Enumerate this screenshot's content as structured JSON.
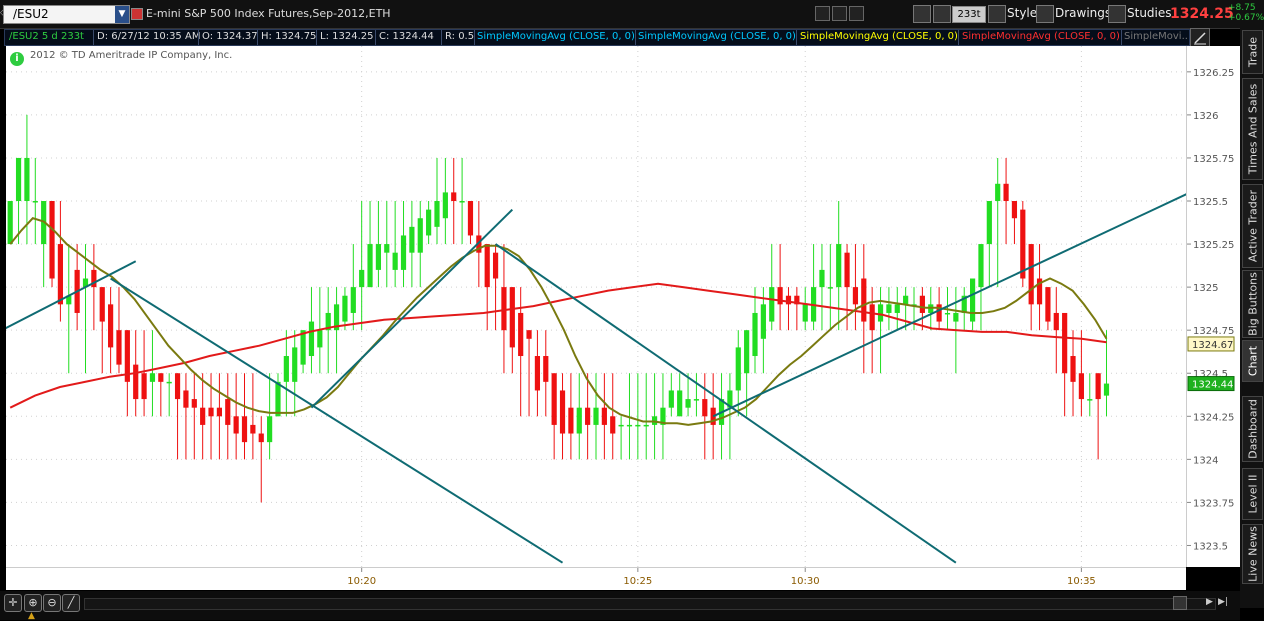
{
  "header": {
    "symbol": "/ESU2",
    "description": "E-mini S&P 500 Index Futures,Sep-2012,ETH",
    "aggregation": "233t",
    "style_label": "Style",
    "drawings_label": "Drawings",
    "studies_label": "Studies",
    "last_price": "1324.25",
    "change_abs": "+8.75",
    "change_pct": "+0.67%"
  },
  "infobar": {
    "symbol_info": "/ESU2 5 d 233t",
    "date": "D: 6/27/12 10:35 AM",
    "open": "O: 1324.37",
    "high": "H: 1324.75",
    "low": "L: 1324.25",
    "close": "C: 1324.44",
    "range": "R: 0.5",
    "study1": "SimpleMovingAvg (CLOSE, 0, 0)",
    "study2": "SimpleMovingAvg (CLOSE, 0, 0)",
    "study3": "SimpleMovingAvg (CLOSE, 0, 0)",
    "study4": "SimpleMovingAvg (CLOSE, 0, 0)",
    "study5": "SimpleMovi..."
  },
  "copyright": "2012 © TD Ameritrade IP Company, Inc.",
  "side_tabs": [
    "Trade",
    "Times And Sales",
    "Active Trader",
    "Big Buttons",
    "Chart",
    "Dashboard",
    "Level II",
    "Live News"
  ],
  "active_side_tab": "Chart",
  "colors": {
    "up": "#22dd22",
    "down": "#ee1111",
    "sma_fast": "#7a7a10",
    "sma_slow": "#e21a1a",
    "trendline": "#0f6b73",
    "infobar_symbol": "#2ecc40",
    "study1": "#00c8ff",
    "study2": "#00c8ff",
    "study3": "#ffff00",
    "study4": "#ff3030",
    "study5": "#777777"
  },
  "chart_data": {
    "type": "candlestick",
    "ylim": [
      1323.375,
      1326.4
    ],
    "y_ticks": [
      "1326.25",
      "1326",
      "1325.75",
      "1325.5",
      "1325.25",
      "1325",
      "1324.75",
      "1324.5",
      "1324.25",
      "1324",
      "1323.75",
      "1323.5"
    ],
    "x_ticks": [
      {
        "bar": 42,
        "label": "10:20"
      },
      {
        "bar": 75,
        "label": "10:25"
      },
      {
        "bar": 95,
        "label": "10:30"
      },
      {
        "bar": 128,
        "label": "10:35"
      }
    ],
    "n_slots": 141,
    "price_markers": [
      {
        "value": 1324.67,
        "label": "1324.67",
        "style": "olive"
      },
      {
        "value": 1324.44,
        "label": "1324.44",
        "style": "green"
      }
    ],
    "candles": [
      {
        "o": 1325.25,
        "h": 1325.5,
        "l": 1325.25,
        "c": 1325.5
      },
      {
        "o": 1325.5,
        "h": 1325.75,
        "l": 1325.25,
        "c": 1325.75
      },
      {
        "o": 1325.5,
        "h": 1326.0,
        "l": 1325.25,
        "c": 1325.75
      },
      {
        "o": 1325.5,
        "h": 1325.75,
        "l": 1325.25,
        "c": 1325.5
      },
      {
        "o": 1325.25,
        "h": 1325.5,
        "l": 1325.0,
        "c": 1325.5
      },
      {
        "o": 1325.5,
        "h": 1325.5,
        "l": 1325.0,
        "c": 1325.05
      },
      {
        "o": 1325.25,
        "h": 1325.5,
        "l": 1324.8,
        "c": 1324.9
      },
      {
        "o": 1324.9,
        "h": 1325.25,
        "l": 1324.5,
        "c": 1324.95
      },
      {
        "o": 1325.1,
        "h": 1325.25,
        "l": 1324.75,
        "c": 1324.85
      },
      {
        "o": 1325.0,
        "h": 1325.25,
        "l": 1324.5,
        "c": 1325.05
      },
      {
        "o": 1325.1,
        "h": 1325.25,
        "l": 1324.75,
        "c": 1325.0
      },
      {
        "o": 1325.0,
        "h": 1325.0,
        "l": 1324.5,
        "c": 1324.8
      },
      {
        "o": 1324.9,
        "h": 1325.0,
        "l": 1324.5,
        "c": 1324.65
      },
      {
        "o": 1324.75,
        "h": 1325.0,
        "l": 1324.5,
        "c": 1324.55
      },
      {
        "o": 1324.75,
        "h": 1324.75,
        "l": 1324.25,
        "c": 1324.45
      },
      {
        "o": 1324.55,
        "h": 1324.75,
        "l": 1324.25,
        "c": 1324.35
      },
      {
        "o": 1324.5,
        "h": 1324.75,
        "l": 1324.25,
        "c": 1324.35
      },
      {
        "o": 1324.45,
        "h": 1324.75,
        "l": 1324.25,
        "c": 1324.5
      },
      {
        "o": 1324.5,
        "h": 1324.5,
        "l": 1324.25,
        "c": 1324.45
      },
      {
        "o": 1324.45,
        "h": 1324.5,
        "l": 1324.25,
        "c": 1324.45
      },
      {
        "o": 1324.5,
        "h": 1324.5,
        "l": 1324.0,
        "c": 1324.35
      },
      {
        "o": 1324.4,
        "h": 1324.5,
        "l": 1324.0,
        "c": 1324.3
      },
      {
        "o": 1324.35,
        "h": 1324.5,
        "l": 1324.0,
        "c": 1324.3
      },
      {
        "o": 1324.3,
        "h": 1324.5,
        "l": 1324.0,
        "c": 1324.2
      },
      {
        "o": 1324.3,
        "h": 1324.5,
        "l": 1324.0,
        "c": 1324.25
      },
      {
        "o": 1324.3,
        "h": 1324.5,
        "l": 1324.0,
        "c": 1324.25
      },
      {
        "o": 1324.35,
        "h": 1324.5,
        "l": 1324.0,
        "c": 1324.2
      },
      {
        "o": 1324.25,
        "h": 1324.5,
        "l": 1324.0,
        "c": 1324.15
      },
      {
        "o": 1324.25,
        "h": 1324.5,
        "l": 1324.0,
        "c": 1324.1
      },
      {
        "o": 1324.2,
        "h": 1324.5,
        "l": 1324.0,
        "c": 1324.15
      },
      {
        "o": 1324.15,
        "h": 1324.25,
        "l": 1323.75,
        "c": 1324.1
      },
      {
        "o": 1324.1,
        "h": 1324.5,
        "l": 1324.0,
        "c": 1324.25
      },
      {
        "o": 1324.25,
        "h": 1324.5,
        "l": 1324.25,
        "c": 1324.45
      },
      {
        "o": 1324.45,
        "h": 1324.75,
        "l": 1324.25,
        "c": 1324.6
      },
      {
        "o": 1324.45,
        "h": 1324.75,
        "l": 1324.25,
        "c": 1324.65
      },
      {
        "o": 1324.55,
        "h": 1324.75,
        "l": 1324.5,
        "c": 1324.75
      },
      {
        "o": 1324.6,
        "h": 1325.0,
        "l": 1324.5,
        "c": 1324.8
      },
      {
        "o": 1324.65,
        "h": 1325.0,
        "l": 1324.5,
        "c": 1324.75
      },
      {
        "o": 1324.75,
        "h": 1325.0,
        "l": 1324.5,
        "c": 1324.85
      },
      {
        "o": 1324.75,
        "h": 1325.0,
        "l": 1324.5,
        "c": 1324.9
      },
      {
        "o": 1324.8,
        "h": 1325.0,
        "l": 1324.75,
        "c": 1324.95
      },
      {
        "o": 1324.85,
        "h": 1325.25,
        "l": 1324.75,
        "c": 1325.0
      },
      {
        "o": 1325.0,
        "h": 1325.5,
        "l": 1324.75,
        "c": 1325.1
      },
      {
        "o": 1325.0,
        "h": 1325.5,
        "l": 1325.0,
        "c": 1325.25
      },
      {
        "o": 1325.1,
        "h": 1325.5,
        "l": 1325.0,
        "c": 1325.25
      },
      {
        "o": 1325.2,
        "h": 1325.5,
        "l": 1325.0,
        "c": 1325.25
      },
      {
        "o": 1325.1,
        "h": 1325.5,
        "l": 1325.0,
        "c": 1325.2
      },
      {
        "o": 1325.1,
        "h": 1325.5,
        "l": 1325.0,
        "c": 1325.3
      },
      {
        "o": 1325.2,
        "h": 1325.5,
        "l": 1325.0,
        "c": 1325.35
      },
      {
        "o": 1325.2,
        "h": 1325.5,
        "l": 1325.0,
        "c": 1325.4
      },
      {
        "o": 1325.3,
        "h": 1325.5,
        "l": 1325.25,
        "c": 1325.45
      },
      {
        "o": 1325.35,
        "h": 1325.75,
        "l": 1325.25,
        "c": 1325.5
      },
      {
        "o": 1325.4,
        "h": 1325.75,
        "l": 1325.25,
        "c": 1325.55
      },
      {
        "o": 1325.55,
        "h": 1325.75,
        "l": 1325.25,
        "c": 1325.5
      },
      {
        "o": 1325.5,
        "h": 1325.75,
        "l": 1325.25,
        "c": 1325.5
      },
      {
        "o": 1325.5,
        "h": 1325.5,
        "l": 1325.25,
        "c": 1325.3
      },
      {
        "o": 1325.3,
        "h": 1325.5,
        "l": 1325.0,
        "c": 1325.2
      },
      {
        "o": 1325.25,
        "h": 1325.25,
        "l": 1324.75,
        "c": 1325.0
      },
      {
        "o": 1325.2,
        "h": 1325.25,
        "l": 1324.75,
        "c": 1325.05
      },
      {
        "o": 1325.0,
        "h": 1325.25,
        "l": 1324.5,
        "c": 1324.75
      },
      {
        "o": 1325.0,
        "h": 1325.0,
        "l": 1324.5,
        "c": 1324.65
      },
      {
        "o": 1324.85,
        "h": 1325.0,
        "l": 1324.25,
        "c": 1324.6
      },
      {
        "o": 1324.75,
        "h": 1324.75,
        "l": 1324.25,
        "c": 1324.7
      },
      {
        "o": 1324.6,
        "h": 1324.75,
        "l": 1324.25,
        "c": 1324.4
      },
      {
        "o": 1324.6,
        "h": 1324.75,
        "l": 1324.25,
        "c": 1324.45
      },
      {
        "o": 1324.5,
        "h": 1324.5,
        "l": 1324.0,
        "c": 1324.2
      },
      {
        "o": 1324.4,
        "h": 1324.5,
        "l": 1324.0,
        "c": 1324.15
      },
      {
        "o": 1324.3,
        "h": 1324.5,
        "l": 1324.0,
        "c": 1324.15
      },
      {
        "o": 1324.15,
        "h": 1324.5,
        "l": 1324.0,
        "c": 1324.3
      },
      {
        "o": 1324.3,
        "h": 1324.5,
        "l": 1324.0,
        "c": 1324.2
      },
      {
        "o": 1324.2,
        "h": 1324.5,
        "l": 1324.0,
        "c": 1324.3
      },
      {
        "o": 1324.3,
        "h": 1324.5,
        "l": 1324.0,
        "c": 1324.2
      },
      {
        "o": 1324.25,
        "h": 1324.5,
        "l": 1324.0,
        "c": 1324.15
      },
      {
        "o": 1324.2,
        "h": 1324.25,
        "l": 1324.0,
        "c": 1324.2
      },
      {
        "o": 1324.2,
        "h": 1324.5,
        "l": 1324.0,
        "c": 1324.2
      },
      {
        "o": 1324.2,
        "h": 1324.5,
        "l": 1324.0,
        "c": 1324.2
      },
      {
        "o": 1324.2,
        "h": 1324.5,
        "l": 1324.0,
        "c": 1324.2
      },
      {
        "o": 1324.2,
        "h": 1324.5,
        "l": 1324.0,
        "c": 1324.25
      },
      {
        "o": 1324.2,
        "h": 1324.5,
        "l": 1324.0,
        "c": 1324.3
      },
      {
        "o": 1324.3,
        "h": 1324.5,
        "l": 1324.25,
        "c": 1324.4
      },
      {
        "o": 1324.25,
        "h": 1324.5,
        "l": 1324.25,
        "c": 1324.4
      },
      {
        "o": 1324.3,
        "h": 1324.5,
        "l": 1324.25,
        "c": 1324.35
      },
      {
        "o": 1324.35,
        "h": 1324.5,
        "l": 1324.25,
        "c": 1324.35
      },
      {
        "o": 1324.35,
        "h": 1324.5,
        "l": 1324.0,
        "c": 1324.25
      },
      {
        "o": 1324.3,
        "h": 1324.5,
        "l": 1324.0,
        "c": 1324.2
      },
      {
        "o": 1324.2,
        "h": 1324.5,
        "l": 1324.0,
        "c": 1324.35
      },
      {
        "o": 1324.3,
        "h": 1324.5,
        "l": 1324.0,
        "c": 1324.4
      },
      {
        "o": 1324.4,
        "h": 1324.75,
        "l": 1324.25,
        "c": 1324.65
      },
      {
        "o": 1324.5,
        "h": 1324.75,
        "l": 1324.25,
        "c": 1324.75
      },
      {
        "o": 1324.6,
        "h": 1325.0,
        "l": 1324.5,
        "c": 1324.85
      },
      {
        "o": 1324.7,
        "h": 1325.0,
        "l": 1324.5,
        "c": 1324.9
      },
      {
        "o": 1324.8,
        "h": 1325.25,
        "l": 1324.75,
        "c": 1325.0
      },
      {
        "o": 1325.0,
        "h": 1325.25,
        "l": 1324.75,
        "c": 1324.9
      },
      {
        "o": 1324.95,
        "h": 1325.0,
        "l": 1324.75,
        "c": 1324.9
      },
      {
        "o": 1324.95,
        "h": 1325.0,
        "l": 1324.75,
        "c": 1324.9
      },
      {
        "o": 1324.8,
        "h": 1325.0,
        "l": 1324.75,
        "c": 1324.9
      },
      {
        "o": 1324.8,
        "h": 1325.25,
        "l": 1324.75,
        "c": 1325.0
      },
      {
        "o": 1325.0,
        "h": 1325.25,
        "l": 1324.75,
        "c": 1325.1
      },
      {
        "o": 1325.0,
        "h": 1325.25,
        "l": 1324.75,
        "c": 1325.0
      },
      {
        "o": 1325.0,
        "h": 1325.5,
        "l": 1324.75,
        "c": 1325.25
      },
      {
        "o": 1325.2,
        "h": 1325.25,
        "l": 1324.75,
        "c": 1325.0
      },
      {
        "o": 1325.0,
        "h": 1325.25,
        "l": 1324.75,
        "c": 1324.9
      },
      {
        "o": 1325.05,
        "h": 1325.25,
        "l": 1324.5,
        "c": 1324.8
      },
      {
        "o": 1324.9,
        "h": 1325.0,
        "l": 1324.5,
        "c": 1324.75
      },
      {
        "o": 1324.8,
        "h": 1325.0,
        "l": 1324.5,
        "c": 1324.9
      },
      {
        "o": 1324.85,
        "h": 1325.0,
        "l": 1324.75,
        "c": 1324.9
      },
      {
        "o": 1324.85,
        "h": 1325.0,
        "l": 1324.75,
        "c": 1324.9
      },
      {
        "o": 1324.9,
        "h": 1325.0,
        "l": 1324.75,
        "c": 1324.95
      },
      {
        "o": 1324.9,
        "h": 1325.0,
        "l": 1324.75,
        "c": 1324.9
      },
      {
        "o": 1324.95,
        "h": 1325.0,
        "l": 1324.75,
        "c": 1324.85
      },
      {
        "o": 1324.85,
        "h": 1325.0,
        "l": 1324.75,
        "c": 1324.9
      },
      {
        "o": 1324.9,
        "h": 1325.0,
        "l": 1324.75,
        "c": 1324.8
      },
      {
        "o": 1324.85,
        "h": 1325.0,
        "l": 1324.75,
        "c": 1324.85
      },
      {
        "o": 1324.8,
        "h": 1325.0,
        "l": 1324.5,
        "c": 1324.85
      },
      {
        "o": 1324.85,
        "h": 1325.0,
        "l": 1324.75,
        "c": 1324.95
      },
      {
        "o": 1324.8,
        "h": 1325.0,
        "l": 1324.75,
        "c": 1325.05
      },
      {
        "o": 1325.0,
        "h": 1325.25,
        "l": 1324.75,
        "c": 1325.25
      },
      {
        "o": 1325.25,
        "h": 1325.5,
        "l": 1325.0,
        "c": 1325.5
      },
      {
        "o": 1325.5,
        "h": 1325.75,
        "l": 1325.0,
        "c": 1325.6
      },
      {
        "o": 1325.6,
        "h": 1325.75,
        "l": 1325.25,
        "c": 1325.5
      },
      {
        "o": 1325.5,
        "h": 1325.5,
        "l": 1325.25,
        "c": 1325.4
      },
      {
        "o": 1325.45,
        "h": 1325.5,
        "l": 1325.0,
        "c": 1325.05
      },
      {
        "o": 1325.25,
        "h": 1325.25,
        "l": 1324.75,
        "c": 1324.9
      },
      {
        "o": 1325.05,
        "h": 1325.25,
        "l": 1324.75,
        "c": 1324.9
      },
      {
        "o": 1325.0,
        "h": 1325.0,
        "l": 1324.75,
        "c": 1324.8
      },
      {
        "o": 1324.85,
        "h": 1325.0,
        "l": 1324.5,
        "c": 1324.75
      },
      {
        "o": 1324.85,
        "h": 1324.75,
        "l": 1324.25,
        "c": 1324.5
      },
      {
        "o": 1324.6,
        "h": 1324.75,
        "l": 1324.25,
        "c": 1324.45
      },
      {
        "o": 1324.5,
        "h": 1324.75,
        "l": 1324.25,
        "c": 1324.35
      },
      {
        "o": 1324.35,
        "h": 1324.5,
        "l": 1324.25,
        "c": 1324.35
      },
      {
        "o": 1324.5,
        "h": 1324.5,
        "l": 1324.0,
        "c": 1324.35
      },
      {
        "o": 1324.37,
        "h": 1324.75,
        "l": 1324.25,
        "c": 1324.44
      }
    ],
    "sma_fast": [
      1325.25,
      1325.33,
      1325.4,
      1325.38,
      1325.32,
      1325.25,
      1325.2,
      1325.15,
      1325.1,
      1325.06,
      1325.0,
      1324.93,
      1324.84,
      1324.75,
      1324.66,
      1324.59,
      1324.52,
      1324.46,
      1324.41,
      1324.37,
      1324.33,
      1324.3,
      1324.28,
      1324.27,
      1324.27,
      1324.27,
      1324.29,
      1324.32,
      1324.36,
      1324.42,
      1324.5,
      1324.58,
      1324.65,
      1324.72,
      1324.8,
      1324.87,
      1324.94,
      1325.0,
      1325.06,
      1325.12,
      1325.17,
      1325.21,
      1325.24,
      1325.24,
      1325.22,
      1325.18,
      1325.1,
      1325.0,
      1324.88,
      1324.75,
      1324.6,
      1324.47,
      1324.37,
      1324.3,
      1324.26,
      1324.24,
      1324.22,
      1324.22,
      1324.21,
      1324.21,
      1324.2,
      1324.21,
      1324.22,
      1324.24,
      1324.27,
      1324.3,
      1324.35,
      1324.42,
      1324.49,
      1324.55,
      1324.6,
      1324.66,
      1324.72,
      1324.78,
      1324.83,
      1324.88,
      1324.91,
      1324.92,
      1324.91,
      1324.9,
      1324.89,
      1324.88,
      1324.88,
      1324.87,
      1324.86,
      1324.85,
      1324.85,
      1324.86,
      1324.88,
      1324.92,
      1324.97,
      1325.02,
      1325.05,
      1325.02,
      1324.98,
      1324.9,
      1324.81,
      1324.7
    ],
    "sma_fast_start": 0,
    "sma_slow": [
      1324.3,
      1324.37,
      1324.42,
      1324.45,
      1324.48,
      1324.5,
      1324.53,
      1324.56,
      1324.6,
      1324.63,
      1324.66,
      1324.7,
      1324.74,
      1324.77,
      1324.79,
      1324.81,
      1324.82,
      1324.83,
      1324.84,
      1324.85,
      1324.87,
      1324.89,
      1324.92,
      1324.95,
      1324.98,
      1325.0,
      1325.02,
      1325.0,
      1324.98,
      1324.96,
      1324.94,
      1324.92,
      1324.9,
      1324.88,
      1324.86,
      1324.84,
      1324.8,
      1324.76,
      1324.75,
      1324.74,
      1324.74,
      1324.72,
      1324.71,
      1324.7,
      1324.68
    ],
    "sma_slow_start": 0,
    "trendlines": [
      {
        "x1": -1,
        "y1": 1324.75,
        "x2": 15,
        "y2": 1325.15
      },
      {
        "x1": 12,
        "y1": 1325.05,
        "x2": 66,
        "y2": 1323.4
      },
      {
        "x1": 36,
        "y1": 1324.3,
        "x2": 60,
        "y2": 1325.45
      },
      {
        "x1": 58,
        "y1": 1325.25,
        "x2": 113,
        "y2": 1323.4
      },
      {
        "x1": 84,
        "y1": 1324.25,
        "x2": 141,
        "y2": 1325.55
      }
    ]
  }
}
